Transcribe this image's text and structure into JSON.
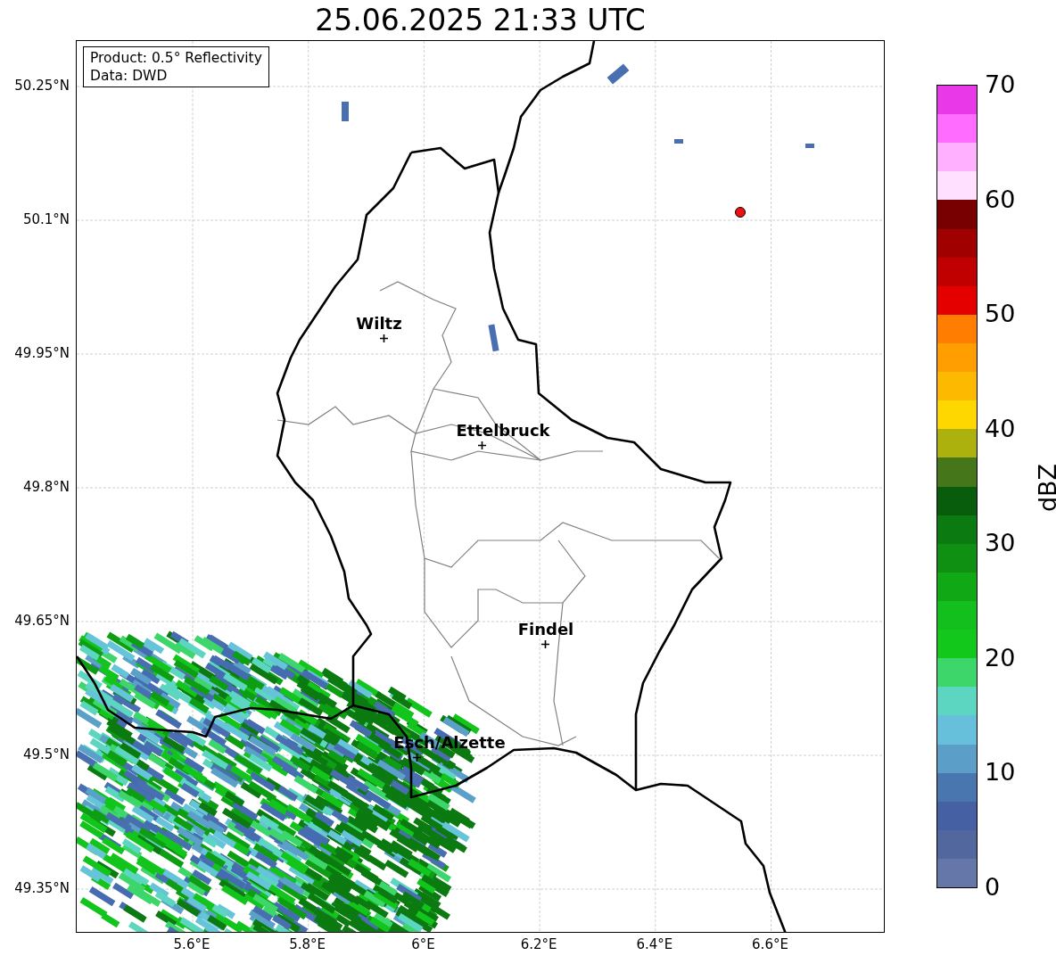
{
  "title": "25.06.2025 21:33 UTC",
  "info_box": [
    "Product: 0.5° Reflectivity",
    "Data: DWD"
  ],
  "lat_labels": [
    "50.25°N",
    "50.1°N",
    "49.95°N",
    "49.8°N",
    "49.65°N",
    "49.5°N",
    "49.35°N"
  ],
  "lon_labels": [
    "5.6°E",
    "5.8°E",
    "6°E",
    "6.2°E",
    "6.4°E",
    "6.6°E"
  ],
  "cities": [
    {
      "name": "Wiltz"
    },
    {
      "name": "Ettelbruck"
    },
    {
      "name": "Findel"
    },
    {
      "name": "Esch/Alzette"
    }
  ],
  "colorbar": {
    "label": "dBZ",
    "ticks": [
      "70",
      "60",
      "50",
      "40",
      "30",
      "20",
      "10",
      "0"
    ],
    "segments": [
      {
        "color": "#e838e8"
      },
      {
        "color": "#ff6cff"
      },
      {
        "color": "#ffb0ff"
      },
      {
        "color": "#ffe0ff"
      },
      {
        "color": "#780000"
      },
      {
        "color": "#a00000"
      },
      {
        "color": "#c00000"
      },
      {
        "color": "#e50000"
      },
      {
        "color": "#ff7d00"
      },
      {
        "color": "#ff9e00"
      },
      {
        "color": "#fdb900"
      },
      {
        "color": "#ffd700"
      },
      {
        "color": "#adb10e"
      },
      {
        "color": "#45771a"
      },
      {
        "color": "#075d0c"
      },
      {
        "color": "#0b7a10"
      },
      {
        "color": "#0f9012"
      },
      {
        "color": "#10a814"
      },
      {
        "color": "#12bf1c"
      },
      {
        "color": "#12c81a"
      },
      {
        "color": "#3dd66a"
      },
      {
        "color": "#5cd6c0"
      },
      {
        "color": "#66c0dc"
      },
      {
        "color": "#5b9ec8"
      },
      {
        "color": "#4a76b0"
      },
      {
        "color": "#4560a3"
      },
      {
        "color": "#52679e"
      },
      {
        "color": "#6577a8"
      }
    ]
  }
}
